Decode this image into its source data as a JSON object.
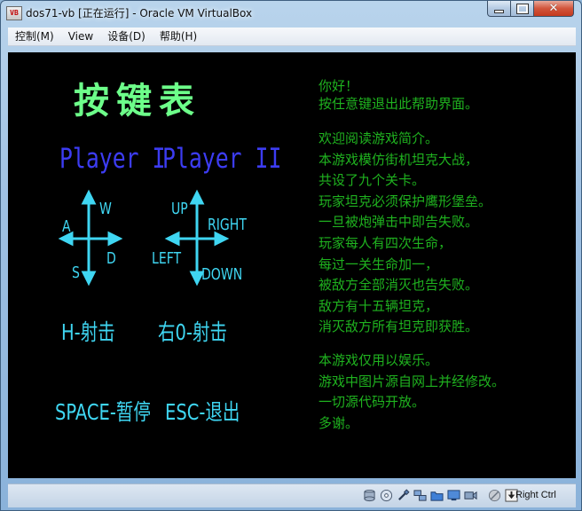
{
  "window": {
    "title": "dos71-vb [正在运行] - Oracle VM VirtualBox",
    "app_icon_text": "VB"
  },
  "menu": [
    "控制(M)",
    "View",
    "设备(D)",
    "帮助(H)"
  ],
  "screen": {
    "heading": "按键表",
    "player1": "Player I",
    "player2": "Player II",
    "p1_keys": {
      "up": "W",
      "left": "A",
      "down": "S",
      "right": "D"
    },
    "p2_keys": {
      "up": "UP",
      "left": "LEFT",
      "down": "DOWN",
      "right": "RIGHT"
    },
    "fire1": "H-射击",
    "fire2": "右0-射击",
    "pause": "SPACE-暂停",
    "quit": "ESC-退出",
    "info_group1": [
      "你好！",
      "按任意键退出此帮助界面。"
    ],
    "info_group2": [
      "欢迎阅读游戏简介。",
      "本游戏模仿街机坦克大战，",
      "共设了九个关卡。",
      "玩家坦克必须保护鹰形堡垒。",
      "一旦被炮弹击中即告失败。",
      "玩家每人有四次生命，",
      "每过一关生命加一，",
      "被敌方全部消灭也告失败。",
      "敌方有十五辆坦克，",
      "消灭敌方所有坦克即获胜。"
    ],
    "info_group3": [
      "本游戏仅用以娱乐。",
      "游戏中图片源自网上并经修改。",
      "一切源代码开放。",
      "多谢。"
    ],
    "colors": {
      "heading": "#6dff8a",
      "players": "#3c3cf2",
      "keys": "#3fd6f2",
      "info": "#1fb21f",
      "background": "#000000"
    }
  },
  "statusbar": {
    "icons": [
      "disk-icon",
      "cd-icon",
      "usb-icon",
      "network-icon",
      "shared-folder-icon",
      "display-icon",
      "recording-icon",
      "mouse-icon",
      "keyboard-icon"
    ],
    "host_key": "Right Ctrl"
  }
}
